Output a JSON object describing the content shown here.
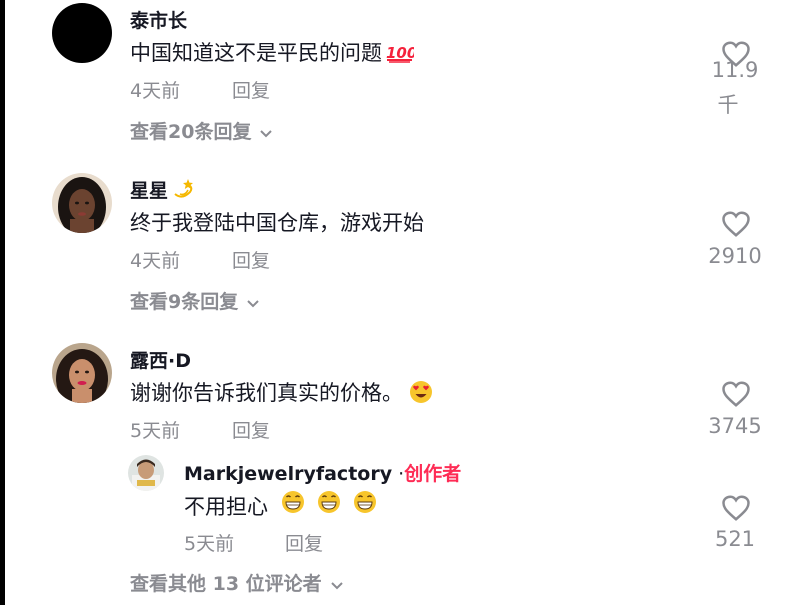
{
  "comments": [
    {
      "username": "泰市长",
      "text": "中国知道这不是平民的问题",
      "emoji": "💯",
      "time": "4天前",
      "reply_label": "回复",
      "likes_line1": "11.9",
      "likes_line2": "千",
      "view_replies": "查看20条回复"
    },
    {
      "username": "星星",
      "username_emoji": "💫",
      "text": "终于我登陆中国仓库，游戏开始",
      "time": "4天前",
      "reply_label": "回复",
      "likes": "2910",
      "view_replies": "查看9条回复"
    },
    {
      "username": "露西·D",
      "text": "谢谢你告诉我们真实的价格。",
      "emoji": "😍",
      "time": "5天前",
      "reply_label": "回复",
      "likes": "3745",
      "reply": {
        "username": "Markjewelryfactory",
        "separator": " ·",
        "creator_tag": "创作者",
        "text": "不用担心",
        "emojis": "😁 😁 😁",
        "time": "5天前",
        "reply_label": "回复",
        "likes": "521"
      }
    }
  ],
  "view_more_comments": "查看其他 13 位评论者",
  "colors": {
    "text": "#161823",
    "secondary": "#8a8b91",
    "creator": "#fe2c55"
  },
  "icons": [
    "heart-icon",
    "chevron-down-icon"
  ]
}
